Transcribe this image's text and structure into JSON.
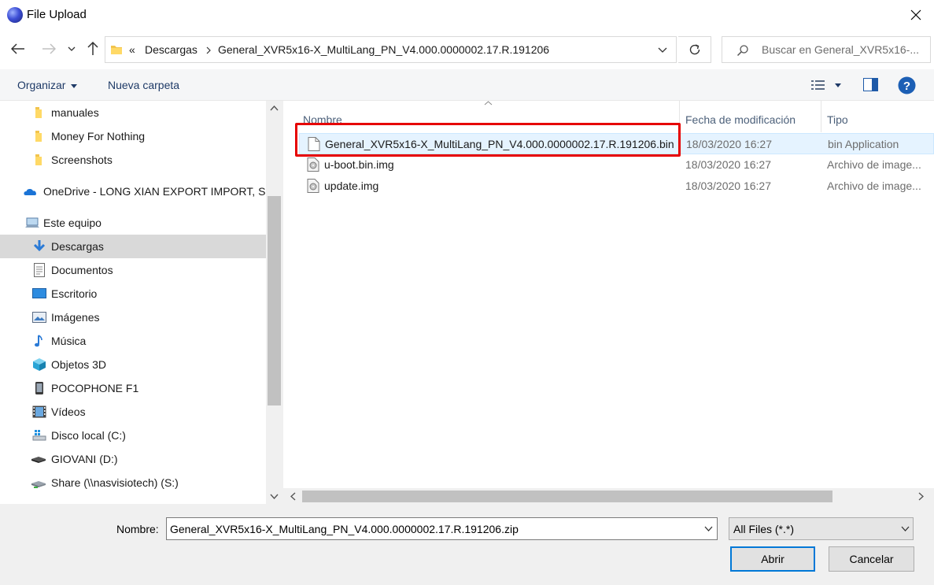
{
  "window": {
    "title": "File Upload"
  },
  "nav": {
    "path": [
      {
        "label": "Descargas"
      },
      {
        "label": "General_XVR5x16-X_MultiLang_PN_V4.000.0000002.17.R.191206"
      }
    ],
    "overflow_chevron": "«",
    "search_placeholder": "Buscar en General_XVR5x16-..."
  },
  "toolbar": {
    "organize_label": "Organizar",
    "new_folder_label": "Nueva carpeta"
  },
  "sidebar": {
    "items": [
      {
        "label": "manuales",
        "icon": "folder-icon"
      },
      {
        "label": "Money For Nothing",
        "icon": "folder-icon"
      },
      {
        "label": "Screenshots",
        "icon": "folder-icon"
      },
      {
        "label": "OneDrive - LONG XIAN EXPORT IMPORT, SL",
        "icon": "onedrive-icon"
      },
      {
        "label": "Este equipo",
        "icon": "computer-icon"
      },
      {
        "label": "Descargas",
        "icon": "downloads-icon",
        "selected": true
      },
      {
        "label": "Documentos",
        "icon": "documents-icon"
      },
      {
        "label": "Escritorio",
        "icon": "desktop-icon"
      },
      {
        "label": "Imágenes",
        "icon": "pictures-icon"
      },
      {
        "label": "Música",
        "icon": "music-icon"
      },
      {
        "label": "Objetos 3D",
        "icon": "3d-objects-icon"
      },
      {
        "label": "POCOPHONE F1",
        "icon": "phone-icon"
      },
      {
        "label": "Vídeos",
        "icon": "videos-icon"
      },
      {
        "label": "Disco local (C:)",
        "icon": "local-disk-icon"
      },
      {
        "label": "GIOVANI (D:)",
        "icon": "drive-icon"
      },
      {
        "label": "Share (\\\\nasvisiotech) (S:)",
        "icon": "network-drive-icon"
      }
    ]
  },
  "filelist": {
    "columns": {
      "name": "Nombre",
      "date": "Fecha de modificación",
      "type": "Tipo"
    },
    "rows": [
      {
        "name": "General_XVR5x16-X_MultiLang_PN_V4.000.0000002.17.R.191206.bin",
        "date": "18/03/2020 16:27",
        "type": "bin Application",
        "icon": "file-icon"
      },
      {
        "name": "u-boot.bin.img",
        "date": "18/03/2020 16:27",
        "type": "Archivo de image...",
        "icon": "disc-image-icon"
      },
      {
        "name": "update.img",
        "date": "18/03/2020 16:27",
        "type": "Archivo de image...",
        "icon": "disc-image-icon"
      }
    ]
  },
  "footer": {
    "filename_label": "Nombre:",
    "filename_value": "General_XVR5x16-X_MultiLang_PN_V4.000.0000002.17.R.191206.zip",
    "filetype_value": "All Files (*.*)",
    "open_label": "Abrir",
    "cancel_label": "Cancelar"
  },
  "colors": {
    "accent": "#0078d7",
    "highlight": "#e60000",
    "selected_bg": "#d9d9d9"
  }
}
